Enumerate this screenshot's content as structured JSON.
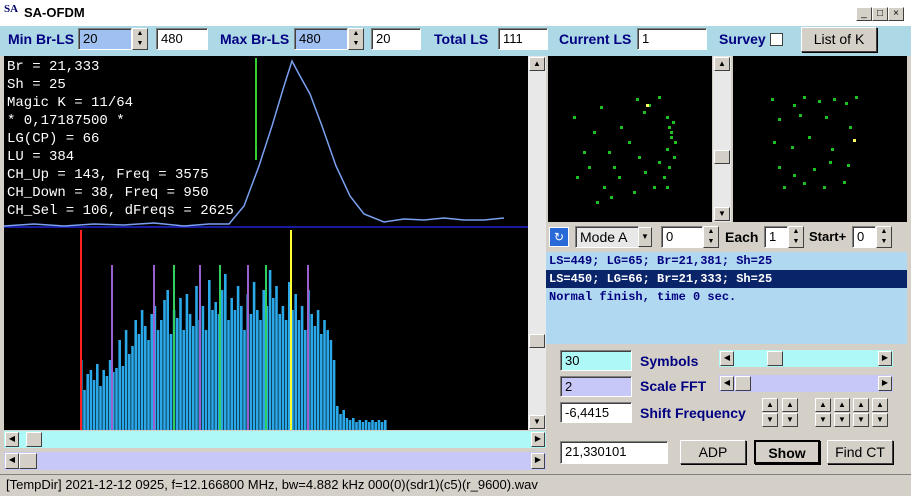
{
  "window": {
    "title": "SA-OFDM",
    "icon_letters": "SA"
  },
  "controls": {
    "min_br_label": "Min Br-LS",
    "min_br_value": "20",
    "min_br_limit": "480",
    "max_br_label": "Max Br-LS",
    "max_br_value": "480",
    "max_br_limit": "20",
    "total_ls_label": "Total LS",
    "total_ls_value": "111",
    "current_ls_label": "Current LS",
    "current_ls_value": "1",
    "survey_label": "Survey",
    "list_button": "List of K"
  },
  "stats": [
    "Br = 21,333",
    "Sh = 25",
    "Magic K = 11/64",
    "* 0,17187500 *",
    "LG(CP) = 66",
    "LU = 384",
    "CH_Up = 143, Freq = 3575",
    "CH_Down = 38, Freq = 950",
    "CH_Sel = 106, dFreqs = 2625"
  ],
  "mode": {
    "label": "Mode A",
    "offset_value": "0",
    "each_label": "Each",
    "each_value": "1",
    "start_label": "Start+",
    "start_value": "0"
  },
  "log": [
    "LS=449; LG=65; Br=21,381; Sh=25",
    "LS=450; LG=66; Br=21,333; Sh=25",
    "Normal finish, time 0 sec."
  ],
  "params": {
    "symbols_value": "30",
    "symbols_label": "Symbols",
    "scale_value": "2",
    "scale_label": "Scale FFT",
    "shift_value": "-6,4415",
    "shift_label": "Shift Frequency",
    "result_value": "21,330101",
    "adp_button": "ADP",
    "show_button": "Show",
    "find_ct_button": "Find CT"
  },
  "status": "[TempDir] 2021-12-12 0925, f=12.166800 MHz, bw=4.882 kHz 000(0)(sdr1)(c5)(r_9600).wav",
  "chart_data": {
    "type": "bar",
    "bar_color": "#2aa8e8",
    "marker_colors": {
      "up": "#ff2020",
      "sel": "#ffff30",
      "down": "#30d030"
    },
    "spectrum_values": [
      0.35,
      0.2,
      0.28,
      0.3,
      0.25,
      0.33,
      0.22,
      0.3,
      0.27,
      0.35,
      0.29,
      0.31,
      0.45,
      0.32,
      0.5,
      0.38,
      0.42,
      0.55,
      0.48,
      0.6,
      0.52,
      0.45,
      0.58,
      0.62,
      0.5,
      0.55,
      0.65,
      0.7,
      0.48,
      0.6,
      0.56,
      0.66,
      0.5,
      0.68,
      0.58,
      0.52,
      0.72,
      0.55,
      0.62,
      0.5,
      0.75,
      0.6,
      0.64,
      0.58,
      0.7,
      0.78,
      0.55,
      0.66,
      0.6,
      0.72,
      0.62,
      0.5,
      0.68,
      0.58,
      0.74,
      0.6,
      0.55,
      0.7,
      0.62,
      0.8,
      0.66,
      0.72,
      0.58,
      0.62,
      0.55,
      0.74,
      0.6,
      0.68,
      0.55,
      0.62,
      0.5,
      0.7,
      0.58,
      0.52,
      0.6,
      0.48,
      0.55,
      0.5,
      0.45,
      0.35,
      0.12,
      0.08,
      0.1,
      0.06,
      0.05,
      0.06,
      0.04,
      0.05,
      0.04,
      0.05,
      0.04,
      0.05,
      0.04,
      0.05,
      0.04,
      0.05
    ]
  }
}
